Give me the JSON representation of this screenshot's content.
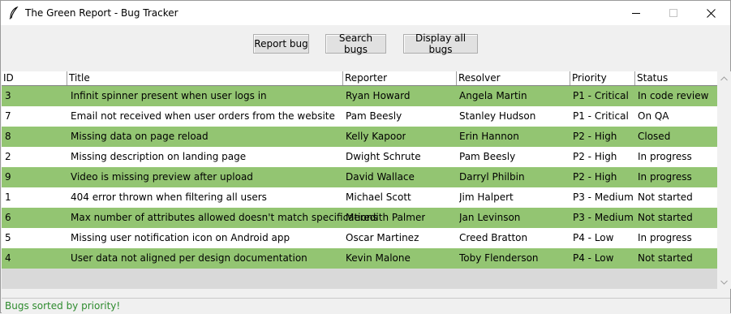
{
  "window": {
    "title": "The Green Report - Bug Tracker",
    "icons": {
      "app": "feather-icon",
      "minimize": "minimize-icon",
      "maximize": "maximize-icon",
      "close": "close-icon"
    }
  },
  "toolbar": {
    "report_label": "Report bug",
    "search_label": "Search bugs",
    "display_label": "Display all bugs"
  },
  "table": {
    "columns": [
      "ID",
      "Title",
      "Reporter",
      "Resolver",
      "Priority",
      "Status"
    ],
    "rows": [
      {
        "id": "3",
        "title": "Infinit spinner present when user logs in",
        "reporter": "Ryan Howard",
        "resolver": "Angela Martin",
        "priority": "P1 - Critical",
        "status": "In code review"
      },
      {
        "id": "7",
        "title": "Email not received when user orders from the website",
        "reporter": "Pam Beesly",
        "resolver": "Stanley Hudson",
        "priority": "P1 - Critical",
        "status": "On QA"
      },
      {
        "id": "8",
        "title": "Missing data on page reload",
        "reporter": "Kelly Kapoor",
        "resolver": "Erin Hannon",
        "priority": "P2 - High",
        "status": "Closed"
      },
      {
        "id": "2",
        "title": "Missing description on landing page",
        "reporter": "Dwight Schrute",
        "resolver": "Pam Beesly",
        "priority": "P2 - High",
        "status": "In progress"
      },
      {
        "id": "9",
        "title": "Video is missing preview after upload",
        "reporter": "David Wallace",
        "resolver": "Darryl Philbin",
        "priority": "P2 - High",
        "status": "In progress"
      },
      {
        "id": "1",
        "title": "404 error thrown when filtering all users",
        "reporter": "Michael Scott",
        "resolver": "Jim Halpert",
        "priority": "P3 - Medium",
        "status": "Not started"
      },
      {
        "id": "6",
        "title": "Max number of attributes allowed doesn't match specifications",
        "reporter": "Meredith Palmer",
        "resolver": "Jan Levinson",
        "priority": "P3 - Medium",
        "status": "Not started"
      },
      {
        "id": "5",
        "title": "Missing user notification icon on Android app",
        "reporter": "Oscar Martinez",
        "resolver": "Creed Bratton",
        "priority": "P4 - Low",
        "status": "In progress"
      },
      {
        "id": "4",
        "title": "User data not aligned per design documentation",
        "reporter": "Kevin Malone",
        "resolver": "Toby Flenderson",
        "priority": "P4 - Low",
        "status": "Not started"
      }
    ],
    "row_colors": {
      "highlight": "#93c572",
      "plain": "#ffffff"
    }
  },
  "status_bar": {
    "message": "Bugs sorted by priority!",
    "color": "#2e8b2e"
  }
}
